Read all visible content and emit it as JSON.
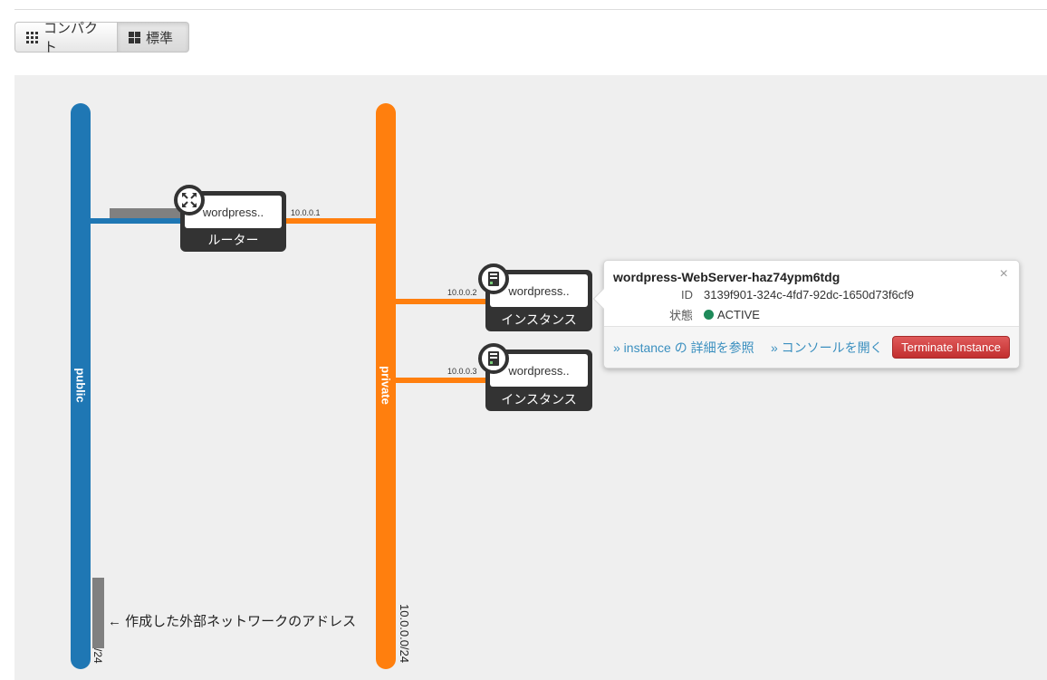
{
  "toolbar": {
    "compact_label": "コンパクト",
    "normal_label": "標準"
  },
  "networks": {
    "public": {
      "name": "public",
      "cidr": "/24",
      "color": "#1f77b4"
    },
    "private": {
      "name": "private",
      "cidr": "10.0.0.0/24",
      "color": "#ff7f0e"
    }
  },
  "router": {
    "name": "wordpress..",
    "caption": "ルーター",
    "ip": "10.0.0.1",
    "icon": "router-icon"
  },
  "instances": [
    {
      "name": "wordpress..",
      "caption": "インスタンス",
      "ip": "10.0.0.2",
      "icon": "server-icon"
    },
    {
      "name": "wordpress..",
      "caption": "インスタンス",
      "ip": "10.0.0.3",
      "icon": "server-icon"
    }
  ],
  "popup": {
    "title": "wordpress-WebServer-haz74ypm6tdg",
    "id_label": "ID",
    "id_value": "3139f901-324c-4fd7-92dc-1650d73f6cf9",
    "status_label": "状態",
    "status_value": "ACTIVE",
    "status_color": "#1f8a5a",
    "close": "×",
    "detail_link": "» instance の 詳細を参照",
    "console_link": "» コンソールを開く",
    "terminate_label": "Terminate Instance"
  },
  "annotation": "← 作成した外部ネットワークのアドレス"
}
